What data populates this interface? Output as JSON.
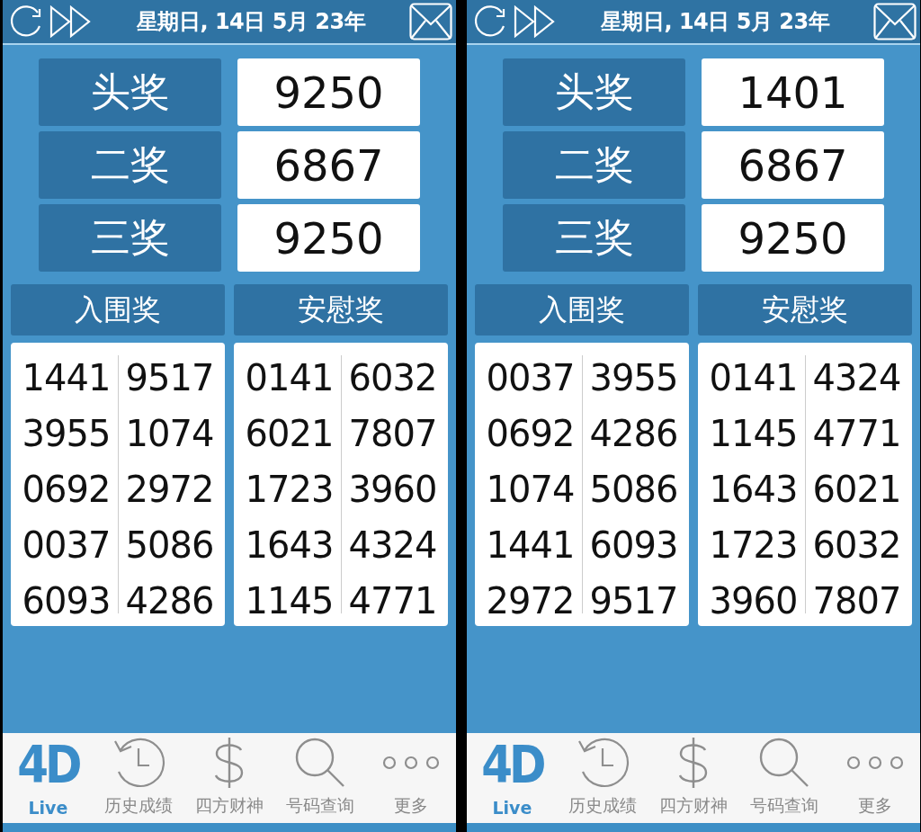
{
  "screens": [
    {
      "date": "星期日, 14日 5月 23年",
      "prizes": [
        {
          "label": "头奖",
          "value": "9250"
        },
        {
          "label": "二奖",
          "value": "6867"
        },
        {
          "label": "三奖",
          "value": "9250"
        }
      ],
      "sections": [
        {
          "title": "入围奖",
          "rows": [
            [
              "1441",
              "9517"
            ],
            [
              "3955",
              "1074"
            ],
            [
              "0692",
              "2972"
            ],
            [
              "0037",
              "5086"
            ],
            [
              "6093",
              "4286"
            ]
          ]
        },
        {
          "title": "安慰奖",
          "rows": [
            [
              "0141",
              "6032"
            ],
            [
              "6021",
              "7807"
            ],
            [
              "1723",
              "3960"
            ],
            [
              "1643",
              "4324"
            ],
            [
              "1145",
              "4771"
            ]
          ]
        }
      ],
      "nav": [
        {
          "kind": "logo",
          "logo_text": "4D",
          "label": "Live",
          "selected": true
        },
        {
          "kind": "history",
          "label": "历史成绩",
          "selected": false
        },
        {
          "kind": "dollar",
          "label": "四方财神",
          "selected": false
        },
        {
          "kind": "search",
          "label": "号码查询",
          "selected": false
        },
        {
          "kind": "more",
          "label": "更多",
          "selected": false
        }
      ]
    },
    {
      "date": "星期日, 14日 5月 23年",
      "prizes": [
        {
          "label": "头奖",
          "value": "1401"
        },
        {
          "label": "二奖",
          "value": "6867"
        },
        {
          "label": "三奖",
          "value": "9250"
        }
      ],
      "sections": [
        {
          "title": "入围奖",
          "rows": [
            [
              "0037",
              "3955"
            ],
            [
              "0692",
              "4286"
            ],
            [
              "1074",
              "5086"
            ],
            [
              "1441",
              "6093"
            ],
            [
              "2972",
              "9517"
            ]
          ]
        },
        {
          "title": "安慰奖",
          "rows": [
            [
              "0141",
              "4324"
            ],
            [
              "1145",
              "4771"
            ],
            [
              "1643",
              "6021"
            ],
            [
              "1723",
              "6032"
            ],
            [
              "3960",
              "7807"
            ]
          ]
        }
      ],
      "nav": [
        {
          "kind": "logo",
          "logo_text": "4D",
          "label": "Live",
          "selected": true
        },
        {
          "kind": "history",
          "label": "历史成绩",
          "selected": false
        },
        {
          "kind": "dollar",
          "label": "四方财神",
          "selected": false
        },
        {
          "kind": "search",
          "label": "号码查询",
          "selected": false
        },
        {
          "kind": "more",
          "label": "更多",
          "selected": false
        }
      ]
    }
  ]
}
